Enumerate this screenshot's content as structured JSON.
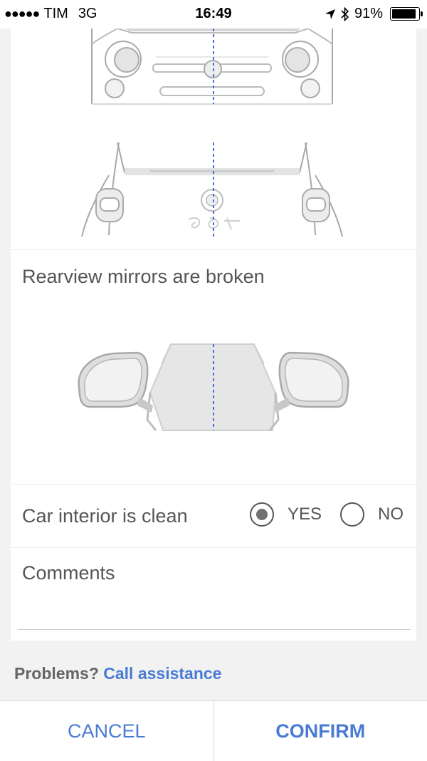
{
  "status_bar": {
    "carrier": "TIM",
    "network": "3G",
    "time": "16:49",
    "battery": "91%",
    "battery_level": 0.91,
    "icons": [
      "signal-dots-icon",
      "location-arrow-icon",
      "bluetooth-icon",
      "battery-icon"
    ]
  },
  "mirrors": {
    "title": "Rearview mirrors are broken"
  },
  "interior": {
    "label": "Car interior is clean",
    "yes_label": "YES",
    "no_label": "NO",
    "selected": "yes"
  },
  "comments": {
    "label": "Comments",
    "value": ""
  },
  "footer": {
    "problems_text": "Problems?",
    "assistance_link": "Call assistance",
    "cancel_label": "CANCEL",
    "confirm_label": "CONFIRM"
  },
  "colors": {
    "accent": "#4a7bd3",
    "text": "#555555",
    "background": "#f2f2f2",
    "dashed_line": "#3f6ed6"
  }
}
